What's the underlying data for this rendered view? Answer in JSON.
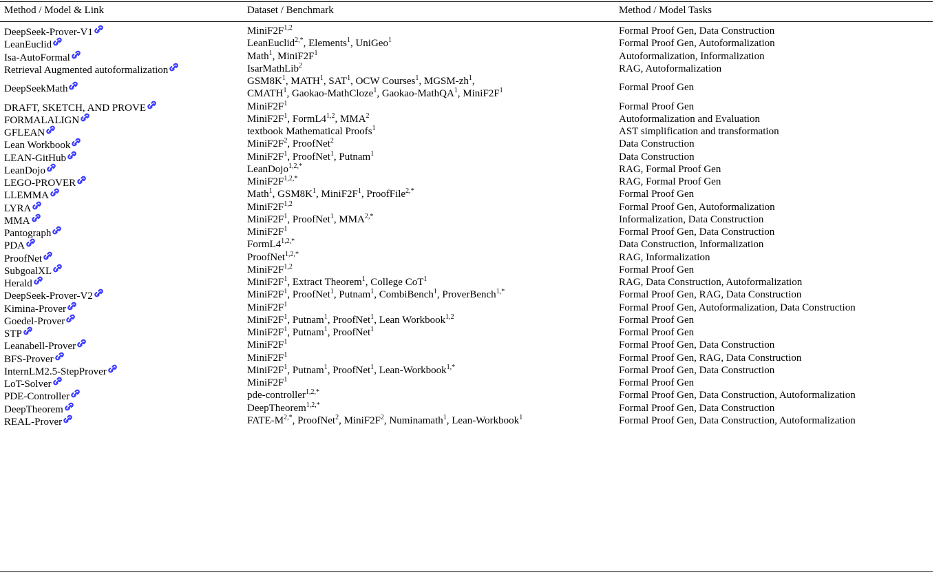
{
  "headers": [
    "Method / Model & Link",
    "Dataset / Benchmark",
    "Method / Model Tasks"
  ],
  "link_icon": "link-icon",
  "link_color": "#3b3bff",
  "rows": [
    {
      "method": "DeepSeek-Prover-V1",
      "datasets": [
        {
          "lines": [
            [
              {
                "text": "MiniF2F",
                "sup": "1,2"
              }
            ]
          ]
        }
      ],
      "tasks": "Formal Proof Gen, Data Construction"
    },
    {
      "method": "LeanEuclid",
      "datasets": [
        {
          "lines": [
            [
              {
                "text": "LeanEuclid",
                "sup": "2,*"
              },
              {
                "text": ", Elements",
                "sup": "1"
              },
              {
                "text": ", UniGeo",
                "sup": "1"
              }
            ]
          ]
        }
      ],
      "tasks": "Formal Proof Gen, Autoformalization"
    },
    {
      "method": "Isa-AutoFormal",
      "datasets": [
        {
          "lines": [
            [
              {
                "text": "Math",
                "sup": "1"
              },
              {
                "text": ", MiniF2F",
                "sup": "1"
              }
            ]
          ]
        }
      ],
      "tasks": "Autoformalization, Informalization"
    },
    {
      "method": "Retrieval Augmented autoformalization",
      "datasets": [
        {
          "lines": [
            [
              {
                "text": "IsarMathLib",
                "sup": "2"
              }
            ]
          ]
        }
      ],
      "tasks": "RAG, Autoformalization"
    },
    {
      "method": "DeepSeekMath",
      "datasets": [
        {
          "lines": [
            [
              {
                "text": "GSM8K",
                "sup": "1"
              },
              {
                "text": ", MATH",
                "sup": "1"
              },
              {
                "text": ", SAT",
                "sup": "1"
              },
              {
                "text": ", OCW Courses",
                "sup": "1"
              },
              {
                "text": ", MGSM-zh",
                "sup": "1"
              },
              {
                "text": ",",
                "sup": ""
              }
            ],
            [
              {
                "text": "CMATH",
                "sup": "1"
              },
              {
                "text": ", Gaokao-MathCloze",
                "sup": "1"
              },
              {
                "text": ", Gaokao-MathQA",
                "sup": "1"
              },
              {
                "text": ", MiniF2F",
                "sup": "1"
              }
            ]
          ]
        }
      ],
      "tasks": "Formal Proof Gen"
    },
    {
      "method": "DRAFT, SKETCH, AND PROVE",
      "datasets": [
        {
          "lines": [
            [
              {
                "text": "MiniF2F",
                "sup": "1"
              }
            ]
          ]
        }
      ],
      "tasks": "Formal Proof Gen"
    },
    {
      "method": "FORMALALIGN",
      "datasets": [
        {
          "lines": [
            [
              {
                "text": "MiniF2F",
                "sup": "1"
              },
              {
                "text": ", FormL4",
                "sup": "1,2"
              },
              {
                "text": ", MMA",
                "sup": "2"
              }
            ]
          ]
        }
      ],
      "tasks": "Autoformalization and Evaluation"
    },
    {
      "method": "GFLEAN",
      "datasets": [
        {
          "lines": [
            [
              {
                "text": "textbook Mathematical Proofs",
                "sup": "1"
              }
            ]
          ]
        }
      ],
      "tasks": "AST simplification and transformation"
    },
    {
      "method": "Lean Workbook",
      "datasets": [
        {
          "lines": [
            [
              {
                "text": "MiniF2F",
                "sup": "2"
              },
              {
                "text": ", ProofNet",
                "sup": "2"
              }
            ]
          ]
        }
      ],
      "tasks": "Data Construction"
    },
    {
      "method": "LEAN-GitHub",
      "datasets": [
        {
          "lines": [
            [
              {
                "text": "MiniF2F",
                "sup": "1"
              },
              {
                "text": ", ProofNet",
                "sup": "1"
              },
              {
                "text": ", Putnam",
                "sup": "1"
              }
            ]
          ]
        }
      ],
      "tasks": "Data Construction"
    },
    {
      "method": "LeanDojo",
      "datasets": [
        {
          "lines": [
            [
              {
                "text": "LeanDojo",
                "sup": "1,2,*"
              }
            ]
          ]
        }
      ],
      "tasks": "RAG, Formal Proof Gen"
    },
    {
      "method": "LEGO-PROVER",
      "datasets": [
        {
          "lines": [
            [
              {
                "text": "MiniF2F",
                "sup": "1,2,*"
              }
            ]
          ]
        }
      ],
      "tasks": "RAG, Formal Proof Gen"
    },
    {
      "method": "LLEMMA",
      "datasets": [
        {
          "lines": [
            [
              {
                "text": "Math",
                "sup": "1"
              },
              {
                "text": ", GSM8K",
                "sup": "1"
              },
              {
                "text": ", MiniF2F",
                "sup": "1"
              },
              {
                "text": ", ProofFile",
                "sup": "2,*"
              }
            ]
          ]
        }
      ],
      "tasks": "Formal Proof Gen"
    },
    {
      "method": "LYRA",
      "datasets": [
        {
          "lines": [
            [
              {
                "text": "MiniF2F",
                "sup": "1,2"
              }
            ]
          ]
        }
      ],
      "tasks": "Formal Proof Gen, Autoformalization"
    },
    {
      "method": "MMA",
      "datasets": [
        {
          "lines": [
            [
              {
                "text": "MiniF2F",
                "sup": "1"
              },
              {
                "text": ", ProofNet",
                "sup": "1"
              },
              {
                "text": ", MMA",
                "sup": "2,*"
              }
            ]
          ]
        }
      ],
      "tasks": "Informalization, Data Construction"
    },
    {
      "method": "Pantograph",
      "datasets": [
        {
          "lines": [
            [
              {
                "text": "MiniF2F",
                "sup": "1"
              }
            ]
          ]
        }
      ],
      "tasks": "Formal Proof Gen, Data Construction"
    },
    {
      "method": "PDA",
      "datasets": [
        {
          "lines": [
            [
              {
                "text": "FormL4",
                "sup": "1,2,*"
              }
            ]
          ]
        }
      ],
      "tasks": "Data Construction, Informalization"
    },
    {
      "method": "ProofNet",
      "datasets": [
        {
          "lines": [
            [
              {
                "text": "ProofNet",
                "sup": "1,2,*"
              }
            ]
          ]
        }
      ],
      "tasks": "RAG, Informalization"
    },
    {
      "method": "SubgoalXL",
      "datasets": [
        {
          "lines": [
            [
              {
                "text": "MiniF2F",
                "sup": "1,2"
              }
            ]
          ]
        }
      ],
      "tasks": "Formal Proof Gen"
    },
    {
      "method": "Herald",
      "datasets": [
        {
          "lines": [
            [
              {
                "text": "MiniF2F",
                "sup": "1"
              },
              {
                "text": ", Extract Theorem",
                "sup": "1"
              },
              {
                "text": ", College CoT",
                "sup": "1"
              }
            ]
          ]
        }
      ],
      "tasks": "RAG, Data Construction, Autoformalization"
    },
    {
      "method": "DeepSeek-Prover-V2",
      "datasets": [
        {
          "lines": [
            [
              {
                "text": "MiniF2F",
                "sup": "1"
              },
              {
                "text": ", ProofNet",
                "sup": "1"
              },
              {
                "text": ", Putnam",
                "sup": "1"
              },
              {
                "text": ", CombiBench",
                "sup": "1"
              },
              {
                "text": ", ProverBench",
                "sup": "1,*"
              }
            ]
          ]
        }
      ],
      "tasks": "Formal Proof Gen, RAG, Data Construction"
    },
    {
      "method": "Kimina-Prover",
      "datasets": [
        {
          "lines": [
            [
              {
                "text": "MiniF2F",
                "sup": "1"
              }
            ]
          ]
        }
      ],
      "tasks": "Formal Proof Gen, Autoformalization, Data Construction"
    },
    {
      "method": "Goedel-Prover",
      "datasets": [
        {
          "lines": [
            [
              {
                "text": "MiniF2F",
                "sup": "1"
              },
              {
                "text": ", Putnam",
                "sup": "1"
              },
              {
                "text": ", ProofNet",
                "sup": "1"
              },
              {
                "text": ", Lean Workbook",
                "sup": "1,2"
              }
            ]
          ]
        }
      ],
      "tasks": "Formal Proof Gen"
    },
    {
      "method": "STP",
      "datasets": [
        {
          "lines": [
            [
              {
                "text": "MiniF2F",
                "sup": "1"
              },
              {
                "text": ", Putnam",
                "sup": "1"
              },
              {
                "text": ", ProofNet",
                "sup": "1"
              }
            ]
          ]
        }
      ],
      "tasks": "Formal Proof Gen"
    },
    {
      "method": "Leanabell-Prover",
      "datasets": [
        {
          "lines": [
            [
              {
                "text": "MiniF2F",
                "sup": "1"
              }
            ]
          ]
        }
      ],
      "tasks": "Formal Proof Gen, Data Construction"
    },
    {
      "method": "BFS-Prover",
      "datasets": [
        {
          "lines": [
            [
              {
                "text": "MiniF2F",
                "sup": "1"
              }
            ]
          ]
        }
      ],
      "tasks": "Formal Proof Gen, RAG, Data Construction"
    },
    {
      "method": "InternLM2.5-StepProver",
      "datasets": [
        {
          "lines": [
            [
              {
                "text": "MiniF2F",
                "sup": "1"
              },
              {
                "text": ", Putnam",
                "sup": "1"
              },
              {
                "text": ", ProofNet",
                "sup": "1"
              },
              {
                "text": ", Lean-Workbook",
                "sup": "1,*"
              }
            ]
          ]
        }
      ],
      "tasks": "Formal Proof Gen, Data Construction"
    },
    {
      "method": "LoT-Solver",
      "datasets": [
        {
          "lines": [
            [
              {
                "text": "MiniF2F",
                "sup": "1"
              }
            ]
          ]
        }
      ],
      "tasks": "Formal Proof Gen"
    },
    {
      "method": "PDE-Controller",
      "datasets": [
        {
          "lines": [
            [
              {
                "text": "pde-controller",
                "sup": "1,2,*"
              }
            ]
          ]
        }
      ],
      "tasks": "Formal Proof Gen, Data Construction, Autoformalization"
    },
    {
      "method": "DeepTheorem",
      "datasets": [
        {
          "lines": [
            [
              {
                "text": "DeepTheorem",
                "sup": "1,2,*"
              }
            ]
          ]
        }
      ],
      "tasks": "Formal Proof Gen, Data Construction"
    },
    {
      "method": "REAL-Prover",
      "datasets": [
        {
          "lines": [
            [
              {
                "text": "FATE-M",
                "sup": "2,*"
              },
              {
                "text": ", ProofNet",
                "sup": "2"
              },
              {
                "text": ", MiniF2F",
                "sup": "2"
              },
              {
                "text": ", Numinamath",
                "sup": "1"
              },
              {
                "text": ", Lean-Workbook",
                "sup": "1"
              }
            ]
          ]
        }
      ],
      "tasks": "Formal Proof Gen, Data Construction, Autoformalization"
    }
  ]
}
